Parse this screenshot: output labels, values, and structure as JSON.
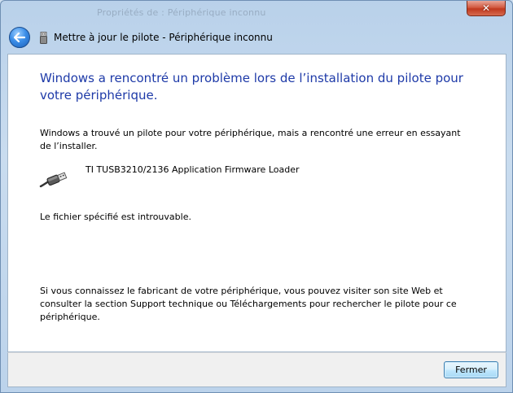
{
  "window": {
    "background_title": "Propriétés de : Périphérique inconnu",
    "close_glyph": "✕"
  },
  "nav": {
    "title": "Mettre à jour le pilote - Périphérique inconnu",
    "back_icon": "back-arrow-icon",
    "device_icon": "usb-device-icon"
  },
  "content": {
    "heading": "Windows a rencontré un problème lors de l’installation du pilote pour votre périphérique.",
    "description": "Windows a trouvé un pilote pour votre périphérique, mais a rencontré une erreur en essayant de l’installer.",
    "device_name": "TI TUSB3210/2136 Application Firmware Loader",
    "error_message": "Le fichier spécifié est introuvable.",
    "help_text": "Si vous connaissez le fabricant de votre périphérique, vous pouvez visiter son site Web et consulter la section Support technique ou Téléchargements pour rechercher le pilote pour ce périphérique."
  },
  "footer": {
    "close_label": "Fermer"
  },
  "colors": {
    "heading": "#1e3aa8",
    "button_border": "#3c7fb1"
  }
}
